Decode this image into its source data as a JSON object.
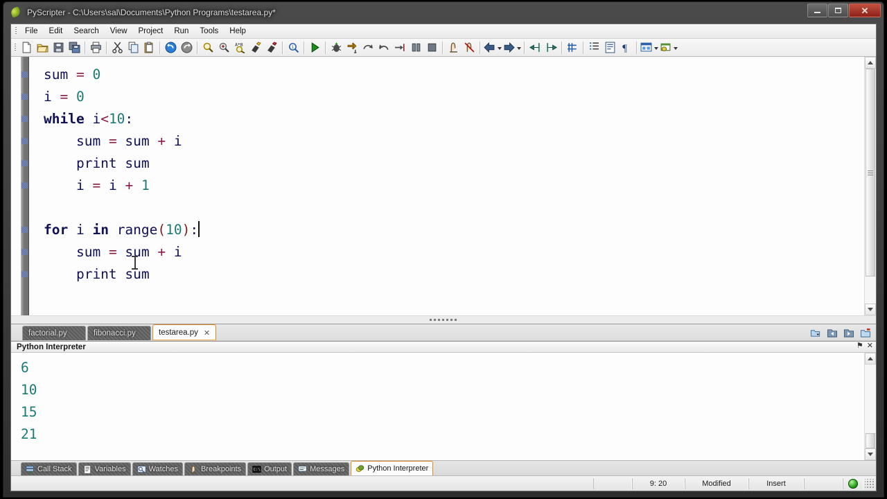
{
  "window": {
    "title": "PyScripter - C:\\Users\\sal\\Documents\\Python Programs\\testarea.py*",
    "app_icon": "python-leaf-icon",
    "minimize_label": "Minimize",
    "maximize_label": "Maximize",
    "close_label": "Close"
  },
  "menu": {
    "items": [
      {
        "label": "File"
      },
      {
        "label": "Edit"
      },
      {
        "label": "Search"
      },
      {
        "label": "View"
      },
      {
        "label": "Project"
      },
      {
        "label": "Run"
      },
      {
        "label": "Tools"
      },
      {
        "label": "Help"
      }
    ]
  },
  "toolbar": {
    "groups": [
      {
        "buttons": [
          {
            "name": "new-file-icon",
            "tip": "New"
          },
          {
            "name": "open-file-icon",
            "tip": "Open"
          },
          {
            "name": "save-icon",
            "tip": "Save"
          },
          {
            "name": "save-all-icon",
            "tip": "Save All"
          }
        ]
      },
      {
        "buttons": [
          {
            "name": "print-icon",
            "tip": "Print"
          }
        ]
      },
      {
        "buttons": [
          {
            "name": "cut-icon",
            "tip": "Cut"
          },
          {
            "name": "copy-icon",
            "tip": "Copy"
          },
          {
            "name": "paste-icon",
            "tip": "Paste"
          }
        ]
      },
      {
        "buttons": [
          {
            "name": "undo-icon",
            "tip": "Undo"
          },
          {
            "name": "redo-icon",
            "tip": "Redo"
          }
        ]
      },
      {
        "buttons": [
          {
            "name": "find-icon",
            "tip": "Find"
          },
          {
            "name": "find-next-icon",
            "tip": "Find Next"
          },
          {
            "name": "replace-icon",
            "tip": "Replace"
          },
          {
            "name": "highlight-icon",
            "tip": "Highlight"
          },
          {
            "name": "highlight-red-icon",
            "tip": "Highlight Search"
          }
        ]
      },
      {
        "buttons": [
          {
            "name": "find-in-files-icon",
            "tip": "Find in Files"
          }
        ]
      },
      {
        "buttons": [
          {
            "name": "run-icon",
            "tip": "Run"
          }
        ]
      },
      {
        "buttons": [
          {
            "name": "debug-icon",
            "tip": "Debug"
          },
          {
            "name": "step-into-icon",
            "tip": "Step Into"
          },
          {
            "name": "step-over-icon",
            "tip": "Step Over"
          },
          {
            "name": "step-out-icon",
            "tip": "Step Out"
          },
          {
            "name": "run-to-cursor-icon",
            "tip": "Run to Cursor"
          },
          {
            "name": "pause-icon",
            "tip": "Pause"
          },
          {
            "name": "stop-icon",
            "tip": "Abort"
          }
        ]
      },
      {
        "buttons": [
          {
            "name": "toggle-breakpoint-icon",
            "tip": "Toggle Breakpoint"
          },
          {
            "name": "clear-breakpoints-icon",
            "tip": "Clear All Breakpoints"
          }
        ]
      },
      {
        "buttons": [
          {
            "name": "nav-back-icon",
            "tip": "Back",
            "dropdown": true
          },
          {
            "name": "nav-forward-icon",
            "tip": "Forward",
            "dropdown": true
          }
        ]
      },
      {
        "buttons": [
          {
            "name": "unindent-icon",
            "tip": "Unindent"
          },
          {
            "name": "indent-icon",
            "tip": "Indent"
          }
        ]
      },
      {
        "buttons": [
          {
            "name": "comment-icon",
            "tip": "Comment"
          }
        ]
      },
      {
        "buttons": [
          {
            "name": "code-explorer-icon",
            "tip": "Code Explorer"
          },
          {
            "name": "wrap-lines-icon",
            "tip": "Word Wrap"
          },
          {
            "name": "show-special-chars-icon",
            "tip": "Show Special Characters"
          }
        ]
      },
      {
        "buttons": [
          {
            "name": "layout-icon",
            "tip": "Layouts",
            "dropdown": true
          },
          {
            "name": "python-engine-icon",
            "tip": "Python Engine",
            "dropdown": true
          }
        ]
      }
    ]
  },
  "editor": {
    "lines": [
      {
        "bp": true,
        "tokens": [
          {
            "t": "sum",
            "c": "id"
          },
          {
            "t": " ",
            "c": "ws"
          },
          {
            "t": "=",
            "c": "op"
          },
          {
            "t": " ",
            "c": "ws"
          },
          {
            "t": "0",
            "c": "num"
          }
        ]
      },
      {
        "bp": true,
        "tokens": [
          {
            "t": "i",
            "c": "id"
          },
          {
            "t": " ",
            "c": "ws"
          },
          {
            "t": "=",
            "c": "op"
          },
          {
            "t": " ",
            "c": "ws"
          },
          {
            "t": "0",
            "c": "num"
          }
        ]
      },
      {
        "bp": true,
        "tokens": [
          {
            "t": "while",
            "c": "kw"
          },
          {
            "t": " i",
            "c": "id"
          },
          {
            "t": "<",
            "c": "op"
          },
          {
            "t": "10",
            "c": "num"
          },
          {
            "t": ":",
            "c": "id"
          }
        ]
      },
      {
        "bp": true,
        "tokens": [
          {
            "t": "    sum",
            "c": "id"
          },
          {
            "t": " ",
            "c": "ws"
          },
          {
            "t": "=",
            "c": "op"
          },
          {
            "t": " sum ",
            "c": "id"
          },
          {
            "t": "+",
            "c": "op"
          },
          {
            "t": " i",
            "c": "id"
          }
        ]
      },
      {
        "bp": true,
        "tokens": [
          {
            "t": "    print",
            "c": "id"
          },
          {
            "t": " sum",
            "c": "id"
          }
        ]
      },
      {
        "bp": true,
        "tokens": [
          {
            "t": "    i",
            "c": "id"
          },
          {
            "t": " ",
            "c": "ws"
          },
          {
            "t": "=",
            "c": "op"
          },
          {
            "t": " i ",
            "c": "id"
          },
          {
            "t": "+",
            "c": "op"
          },
          {
            "t": " ",
            "c": "ws"
          },
          {
            "t": "1",
            "c": "num"
          }
        ]
      },
      {
        "bp": false,
        "tokens": []
      },
      {
        "bp": true,
        "caret": true,
        "tokens": [
          {
            "t": "for",
            "c": "kw"
          },
          {
            "t": " i ",
            "c": "id"
          },
          {
            "t": "in",
            "c": "kw"
          },
          {
            "t": " range",
            "c": "id"
          },
          {
            "t": "(",
            "c": "pn"
          },
          {
            "t": "10",
            "c": "num"
          },
          {
            "t": ")",
            "c": "pn"
          },
          {
            "t": ":",
            "c": "id"
          }
        ]
      },
      {
        "bp": true,
        "tokens": [
          {
            "t": "    sum",
            "c": "id"
          },
          {
            "t": " ",
            "c": "ws"
          },
          {
            "t": "=",
            "c": "op"
          },
          {
            "t": " sum ",
            "c": "id"
          },
          {
            "t": "+",
            "c": "op"
          },
          {
            "t": " i",
            "c": "id"
          }
        ]
      },
      {
        "bp": true,
        "tokens": [
          {
            "t": "    print",
            "c": "id"
          },
          {
            "t": " sum",
            "c": "id"
          }
        ]
      }
    ],
    "colors": {
      "identifier": "#101055",
      "keyword": "#101055",
      "number": "#1b7a74",
      "operator": "#8a1a3c",
      "paren": "#7a2020",
      "background": "#fdfdfd"
    }
  },
  "file_tabs": {
    "items": [
      {
        "label": "factorial.py",
        "active": false
      },
      {
        "label": "fibonacci.py",
        "active": false
      },
      {
        "label": "testarea.py",
        "active": true,
        "close_label": "✕"
      }
    ],
    "right_buttons": [
      {
        "name": "open-recent-icon",
        "dropdown": true
      },
      {
        "name": "previous-file-icon"
      },
      {
        "name": "next-file-icon"
      },
      {
        "name": "close-file-icon"
      }
    ]
  },
  "interpreter_panel": {
    "title": "Python Interpreter",
    "pin_glyph": "⚑",
    "close_glyph": "✕",
    "output_lines": [
      "6",
      "10",
      "15",
      "21"
    ],
    "output_color": "#1b7a74"
  },
  "dock_tabs": {
    "items": [
      {
        "label": "Call Stack",
        "icon": "call-stack-icon",
        "active": false
      },
      {
        "label": "Variables",
        "icon": "variables-icon",
        "active": false
      },
      {
        "label": "Watches",
        "icon": "watches-icon",
        "active": false
      },
      {
        "label": "Breakpoints",
        "icon": "breakpoints-icon",
        "active": false
      },
      {
        "label": "Output",
        "icon": "output-icon",
        "active": false
      },
      {
        "label": "Messages",
        "icon": "messages-icon",
        "active": false
      },
      {
        "label": "Python Interpreter",
        "icon": "python-leaf-icon",
        "active": true
      }
    ]
  },
  "statusbar": {
    "position": "9: 20",
    "modified": "Modified",
    "insert_mode": "Insert",
    "engine_icon": "python-engine-running-icon"
  }
}
